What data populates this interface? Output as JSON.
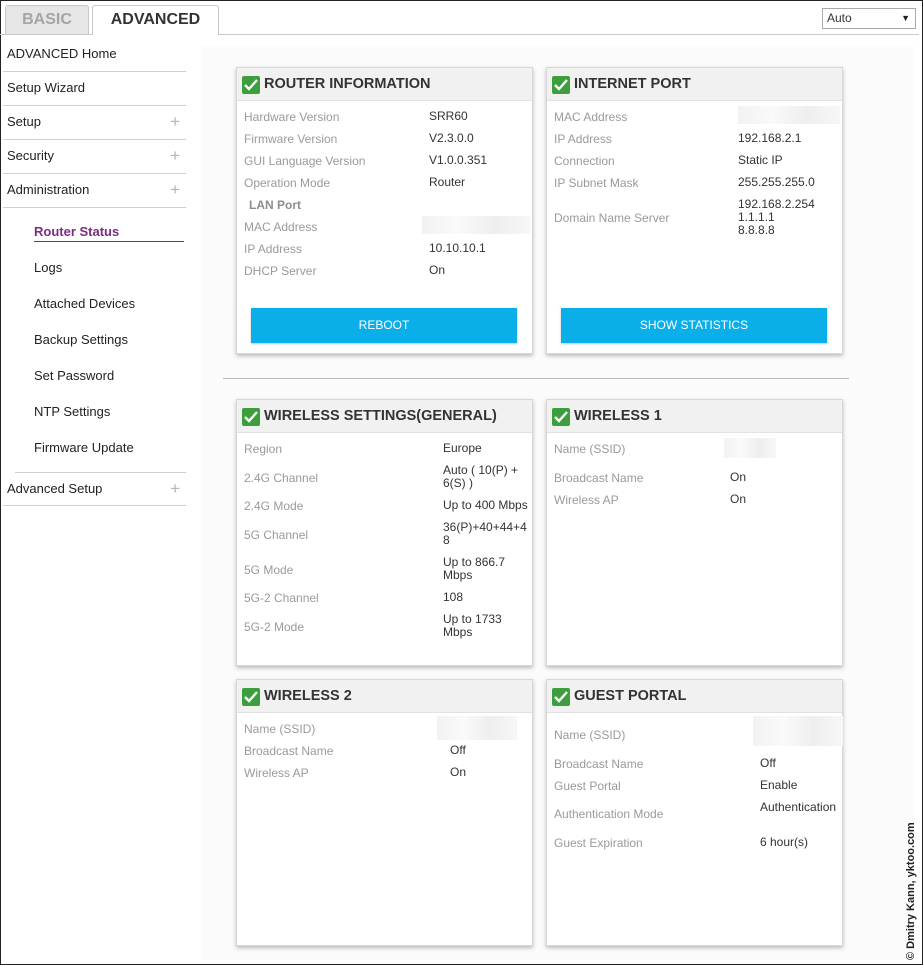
{
  "tabs": {
    "basic": "BASIC",
    "advanced": "ADVANCED"
  },
  "language_select": {
    "value": "Auto"
  },
  "sidebar": {
    "top_items": [
      {
        "label": "ADVANCED Home",
        "expandable": false
      },
      {
        "label": "Setup Wizard",
        "expandable": false
      },
      {
        "label": "Setup",
        "expandable": true
      },
      {
        "label": "Security",
        "expandable": true
      },
      {
        "label": "Administration",
        "expandable": true
      }
    ],
    "admin_items": [
      "Router Status",
      "Logs",
      "Attached Devices",
      "Backup Settings",
      "Set Password",
      "NTP Settings",
      "Firmware Update"
    ],
    "bottom_item": "Advanced Setup",
    "plus_glyph": "+"
  },
  "router_info": {
    "title": "ROUTER INFORMATION",
    "rows": [
      {
        "label": "Hardware Version",
        "value": "SRR60"
      },
      {
        "label": "Firmware Version",
        "value": "V2.3.0.0"
      },
      {
        "label": "GUI Language Version",
        "value": "V1.0.0.351"
      },
      {
        "label": "Operation Mode",
        "value": "Router"
      }
    ],
    "lan_section": "LAN Port",
    "lan_rows": [
      {
        "label": "MAC Address",
        "value": ""
      },
      {
        "label": "IP Address",
        "value": "10.10.10.1"
      },
      {
        "label": "DHCP Server",
        "value": "On"
      }
    ],
    "button": "REBOOT"
  },
  "internet_port": {
    "title": "INTERNET PORT",
    "rows": [
      {
        "label": "MAC Address",
        "value": ""
      },
      {
        "label": "IP Address",
        "value": "192.168.2.1"
      },
      {
        "label": "Connection",
        "value": "Static IP"
      },
      {
        "label": "IP Subnet Mask",
        "value": "255.255.255.0"
      },
      {
        "label": "Domain Name Server",
        "value": ""
      }
    ],
    "dns_values": [
      "192.168.2.254",
      "1.1.1.1",
      "8.8.8.8"
    ],
    "button": "SHOW STATISTICS"
  },
  "wireless_general": {
    "title": "WIRELESS SETTINGS(GENERAL)",
    "rows": [
      {
        "label": "Region",
        "value": "Europe"
      },
      {
        "label": "2.4G Channel",
        "value": "Auto ( 10(P) + 6(S) )"
      },
      {
        "label": "2.4G Mode",
        "value": "Up to 400 Mbps"
      },
      {
        "label": "5G Channel",
        "value": "36(P)+40+44+48"
      },
      {
        "label": "5G Mode",
        "value": "Up to 866.7 Mbps"
      },
      {
        "label": "5G-2 Channel",
        "value": "108"
      },
      {
        "label": "5G-2 Mode",
        "value": "Up to 1733 Mbps"
      }
    ]
  },
  "wireless1": {
    "title": "WIRELESS 1",
    "rows": [
      {
        "label": "Name (SSID)",
        "value": ""
      },
      {
        "label": "Broadcast Name",
        "value": "On"
      },
      {
        "label": "Wireless AP",
        "value": "On"
      }
    ]
  },
  "wireless2": {
    "title": "WIRELESS 2",
    "rows": [
      {
        "label": "Name (SSID)",
        "value": ""
      },
      {
        "label": "Broadcast Name",
        "value": "Off"
      },
      {
        "label": "Wireless AP",
        "value": "On"
      }
    ]
  },
  "guest_portal": {
    "title": "GUEST PORTAL",
    "rows": [
      {
        "label": "Name (SSID)",
        "value": ""
      },
      {
        "label": "Broadcast Name",
        "value": "Off"
      },
      {
        "label": "Guest Portal",
        "value": "Enable"
      },
      {
        "label": "Authentication Mode",
        "value": "Authentication"
      },
      {
        "label": "Guest Expiration",
        "value": "6 hour(s)"
      }
    ]
  },
  "watermark": "© Dmitry Kann, yktoo.com",
  "colors": {
    "accent_purple": "#7b2b83",
    "button_blue": "#0aaee8",
    "check_green": "#3d9e3d"
  },
  "icons": {
    "status": "checkmark-icon",
    "expand": "plus-icon",
    "dropdown": "caret-down-icon"
  }
}
